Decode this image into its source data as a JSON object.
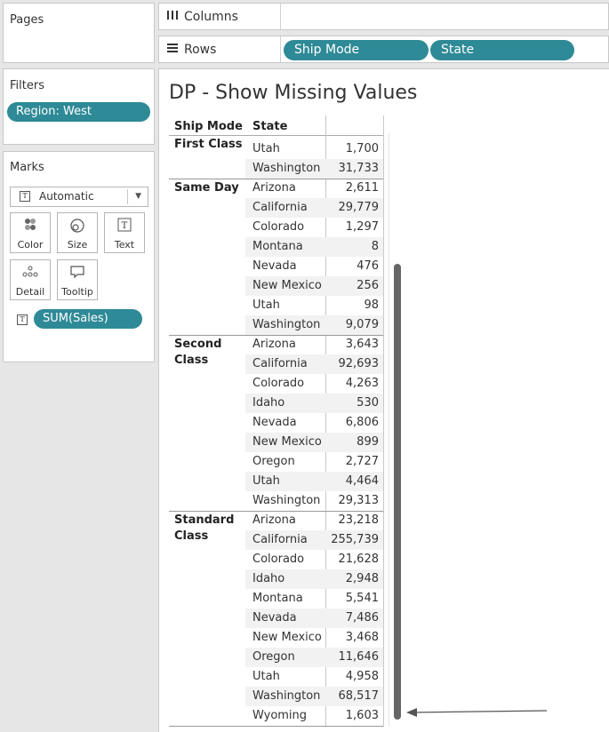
{
  "left_panel": {
    "pages": {
      "title": "Pages"
    },
    "filters": {
      "title": "Filters",
      "pills": [
        "Region: West"
      ]
    },
    "marks": {
      "title": "Marks",
      "type": "Automatic",
      "buttons": [
        {
          "label": "Color",
          "icon": "color-dots-icon"
        },
        {
          "label": "Size",
          "icon": "size-circles-icon"
        },
        {
          "label": "Text",
          "icon": "text-box-icon"
        },
        {
          "label": "Detail",
          "icon": "detail-dots-icon"
        },
        {
          "label": "Tooltip",
          "icon": "tooltip-bubble-icon"
        }
      ],
      "field": "SUM(Sales)"
    }
  },
  "shelves": {
    "columns": {
      "label": "Columns",
      "icon": "columns-icon"
    },
    "rows": {
      "label": "Rows",
      "icon": "rows-icon",
      "pills": [
        "Ship Mode",
        "State"
      ]
    }
  },
  "view": {
    "title": "DP - Show Missing Values",
    "headers": {
      "ship_mode": "Ship Mode",
      "state": "State"
    },
    "groups": [
      {
        "ship_mode": "First Class",
        "rows": [
          {
            "state": "Utah",
            "sales": "1,700"
          },
          {
            "state": "Washington",
            "sales": "31,733"
          }
        ]
      },
      {
        "ship_mode": "Same Day",
        "rows": [
          {
            "state": "Arizona",
            "sales": "2,611"
          },
          {
            "state": "California",
            "sales": "29,779"
          },
          {
            "state": "Colorado",
            "sales": "1,297"
          },
          {
            "state": "Montana",
            "sales": "8"
          },
          {
            "state": "Nevada",
            "sales": "476"
          },
          {
            "state": "New Mexico",
            "sales": "256"
          },
          {
            "state": "Utah",
            "sales": "98"
          },
          {
            "state": "Washington",
            "sales": "9,079"
          }
        ]
      },
      {
        "ship_mode": "Second Class",
        "rows": [
          {
            "state": "Arizona",
            "sales": "3,643"
          },
          {
            "state": "California",
            "sales": "92,693"
          },
          {
            "state": "Colorado",
            "sales": "4,263"
          },
          {
            "state": "Idaho",
            "sales": "530"
          },
          {
            "state": "Nevada",
            "sales": "6,806"
          },
          {
            "state": "New Mexico",
            "sales": "899"
          },
          {
            "state": "Oregon",
            "sales": "2,727"
          },
          {
            "state": "Utah",
            "sales": "4,464"
          },
          {
            "state": "Washington",
            "sales": "29,313"
          }
        ]
      },
      {
        "ship_mode": "Standard Class",
        "rows": [
          {
            "state": "Arizona",
            "sales": "23,218"
          },
          {
            "state": "California",
            "sales": "255,739"
          },
          {
            "state": "Colorado",
            "sales": "21,628"
          },
          {
            "state": "Idaho",
            "sales": "2,948"
          },
          {
            "state": "Montana",
            "sales": "5,541"
          },
          {
            "state": "Nevada",
            "sales": "7,486"
          },
          {
            "state": "New Mexico",
            "sales": "3,468"
          },
          {
            "state": "Oregon",
            "sales": "11,646"
          },
          {
            "state": "Utah",
            "sales": "4,958"
          },
          {
            "state": "Washington",
            "sales": "68,517"
          },
          {
            "state": "Wyoming",
            "sales": "1,603"
          }
        ]
      }
    ]
  },
  "colors": {
    "pill": "#2e8a96",
    "band": "#f2f2f2",
    "arrow": "#555555"
  }
}
